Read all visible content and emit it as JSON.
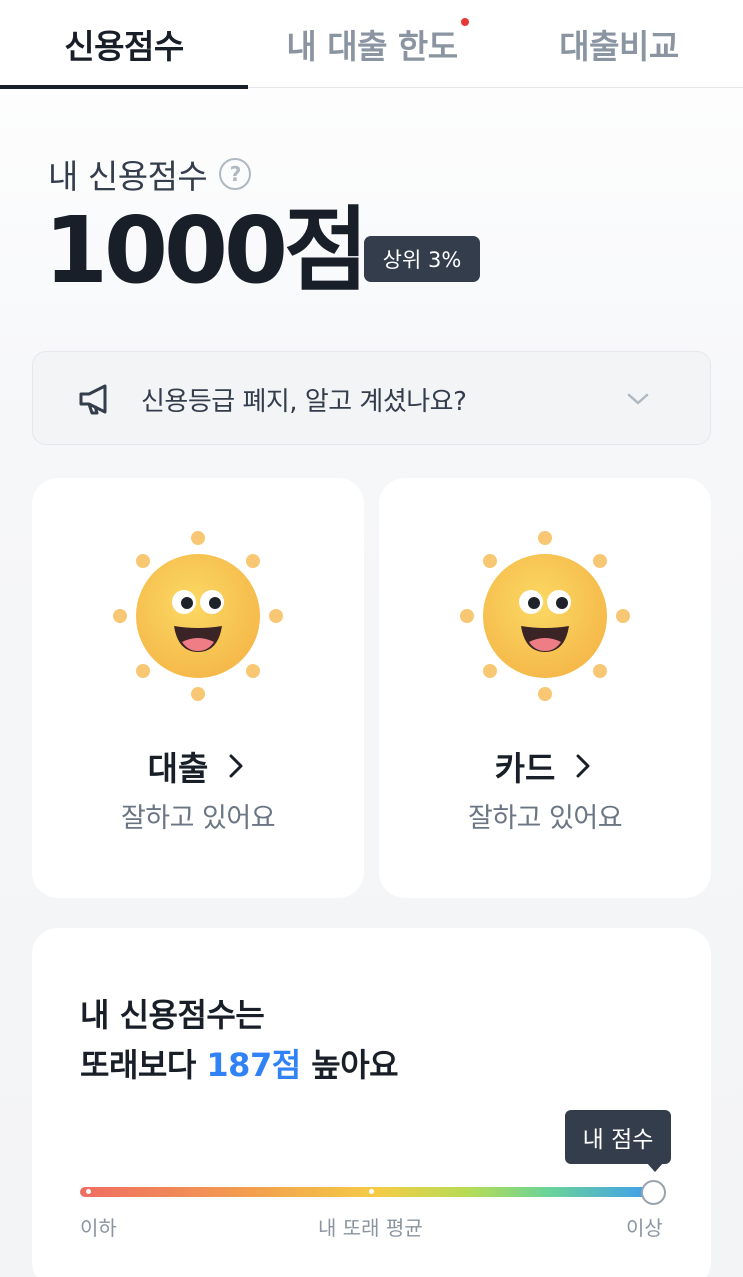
{
  "tabs": [
    {
      "label": "신용점수",
      "active": true
    },
    {
      "label": "내 대출 한도",
      "has_new_dot": true
    },
    {
      "label": "대출비교"
    }
  ],
  "score": {
    "label": "내 신용점수",
    "help_icon": "question-circle-icon",
    "value": "1000점",
    "rank_badge": "상위 3%"
  },
  "notice": {
    "icon": "megaphone-icon",
    "text": "신용등급 폐지, 알고 계셨나요?",
    "chevron": "chevron-down-icon"
  },
  "cards": [
    {
      "title": "대출",
      "subtitle": "잘하고 있어요",
      "icon": "smiling-sun-icon"
    },
    {
      "title": "카드",
      "subtitle": "잘하고 있어요",
      "icon": "smiling-sun-icon"
    }
  ],
  "comparison": {
    "line1": "내 신용점수는",
    "line2_prefix": "또래보다 ",
    "line2_highlight": "187점",
    "line2_suffix": " 높아요",
    "tooltip": "내 점수",
    "scale_left": "이하",
    "scale_middle": "내 또래 평균",
    "scale_right": "이상",
    "my_position_fraction": 0.98,
    "average_position_fraction": 0.5
  },
  "colors": {
    "accent_blue": "#3182f6",
    "dark_badge": "#333d4b",
    "new_dot_red": "#e53935",
    "sun_yellow": "#f9c94a"
  }
}
